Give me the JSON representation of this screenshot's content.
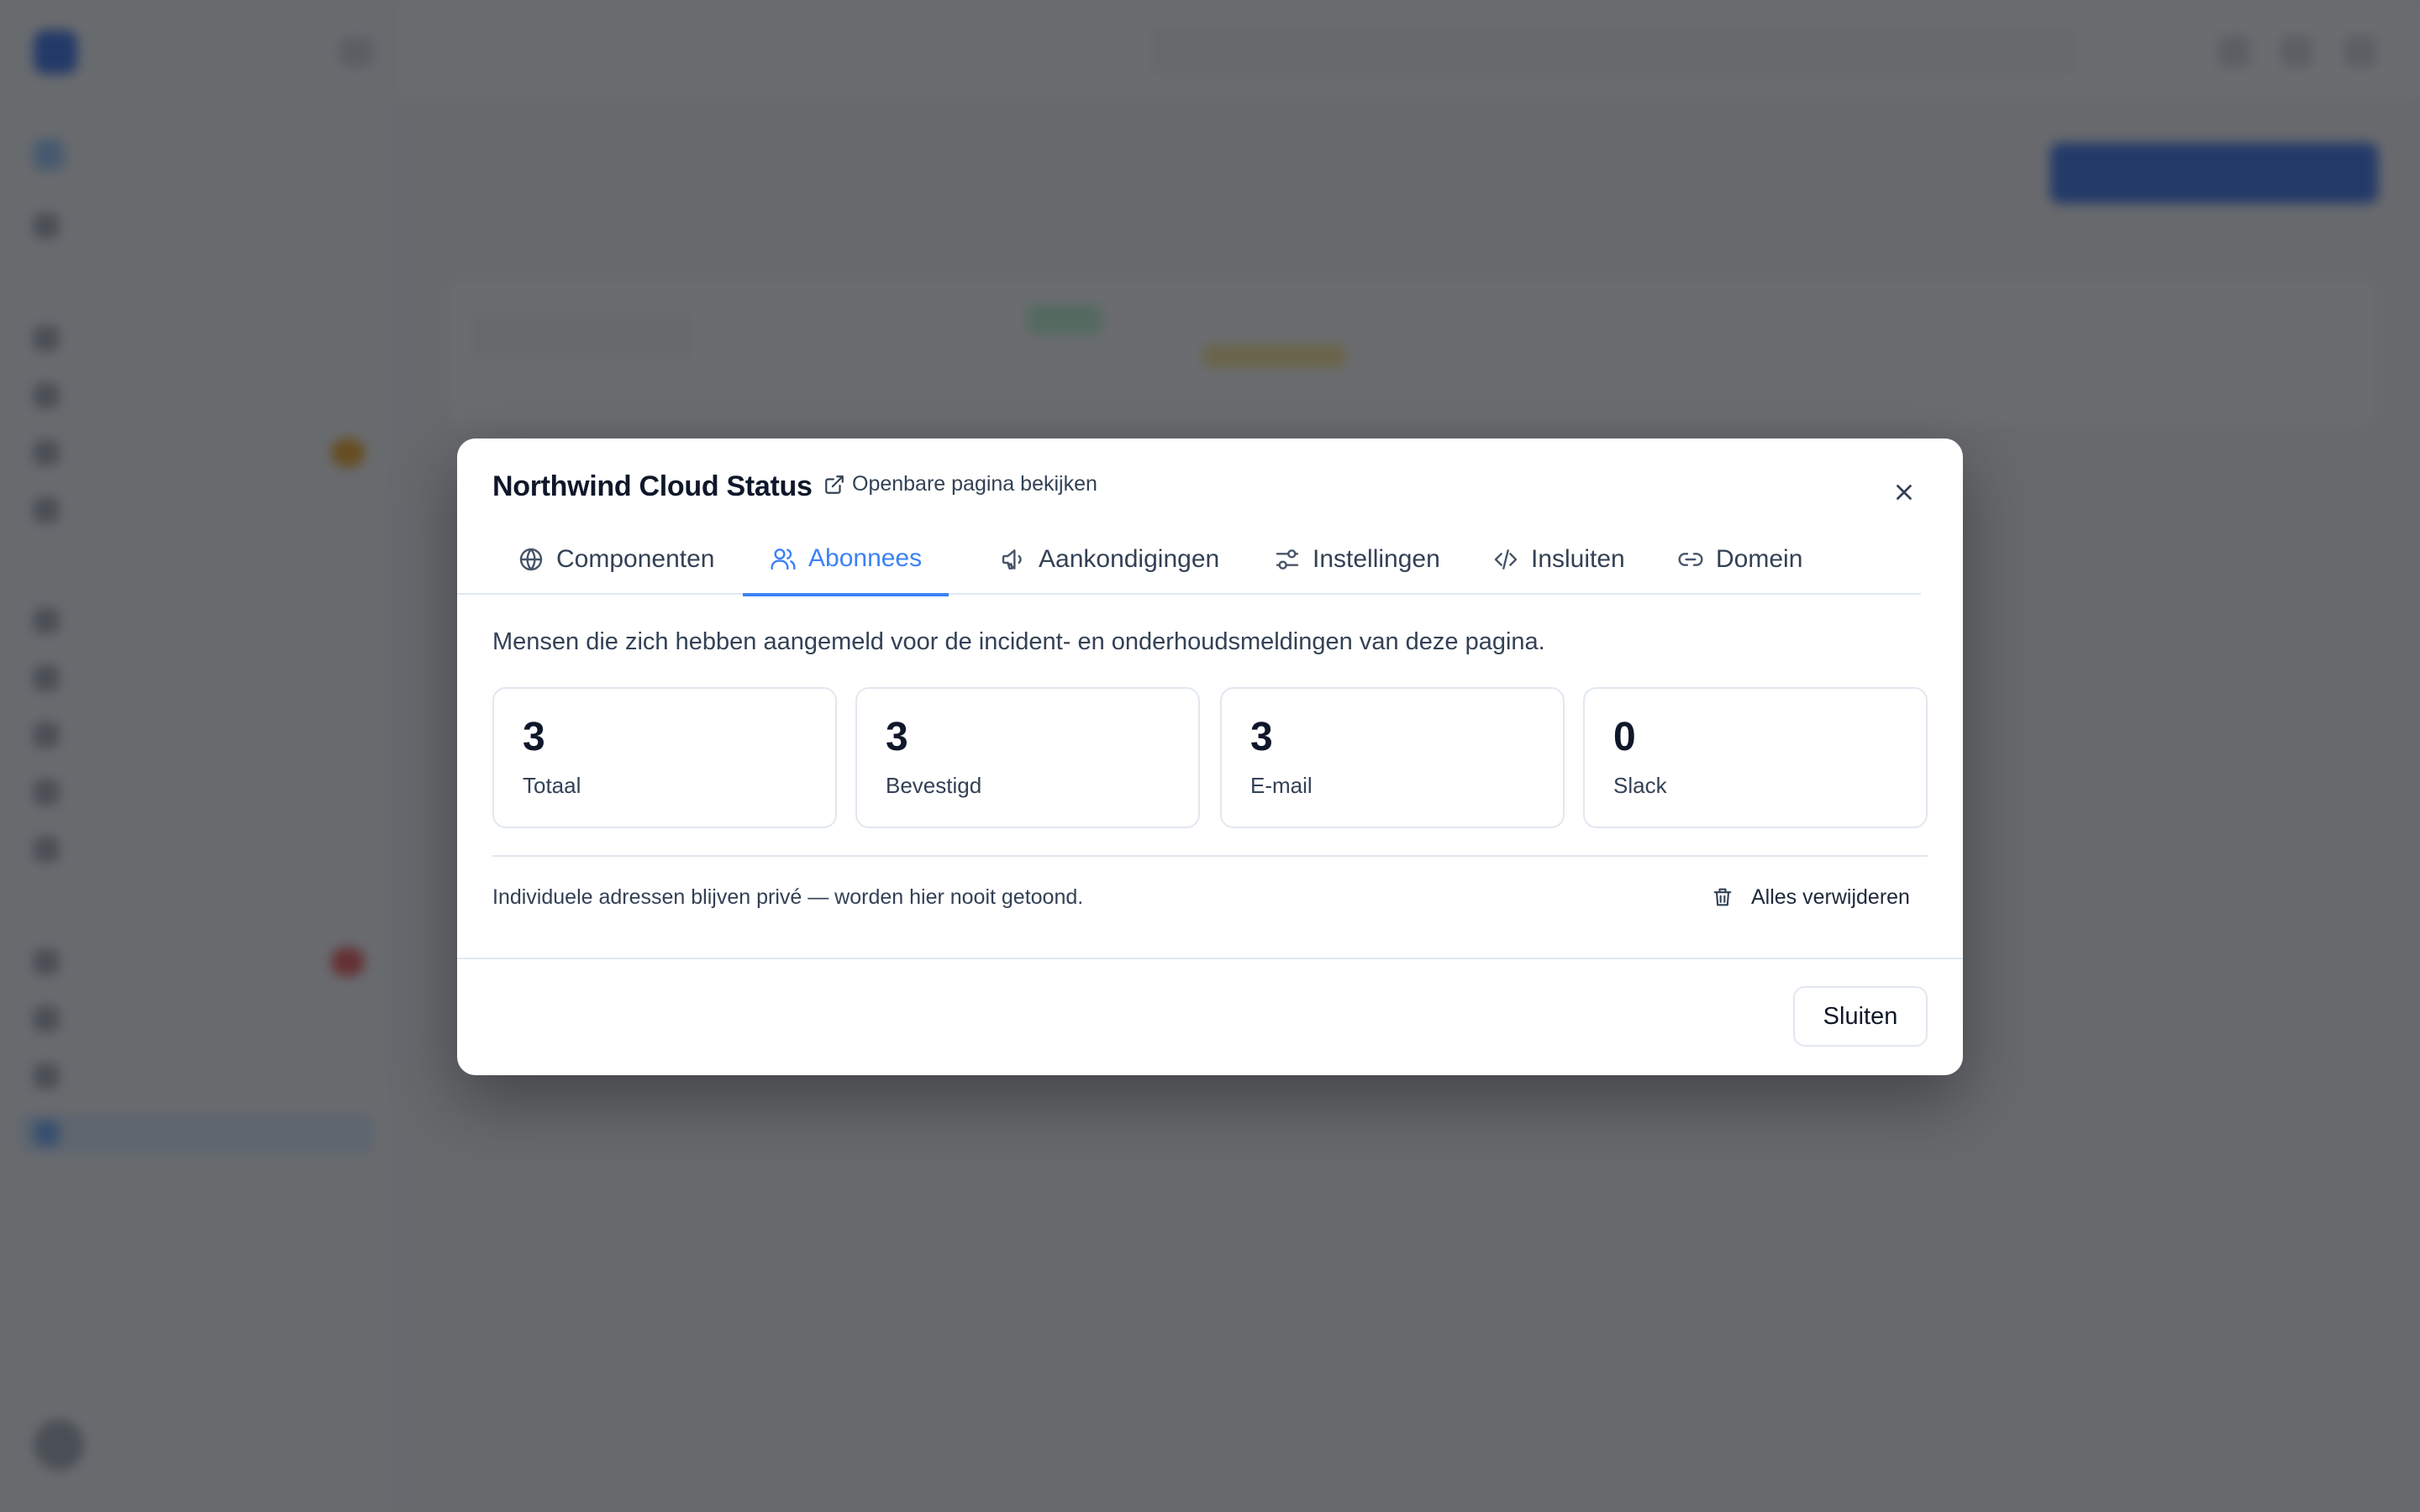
{
  "modal": {
    "title": "Northwind Cloud Status",
    "public_link_label": "Openbare pagina bekijken",
    "tabs": [
      {
        "label": "Componenten",
        "icon": "globe-icon"
      },
      {
        "label": "Abonnees",
        "icon": "users-icon",
        "active": true
      },
      {
        "label": "Aankondigingen",
        "icon": "megaphone-icon"
      },
      {
        "label": "Instellingen",
        "icon": "sliders-icon"
      },
      {
        "label": "Insluiten",
        "icon": "code-icon"
      },
      {
        "label": "Domein",
        "icon": "link-icon"
      }
    ],
    "description": "Mensen die zich hebben aangemeld voor de incident- en onderhoudsmeldingen van deze pagina.",
    "stats": [
      {
        "value": "3",
        "label": "Totaal"
      },
      {
        "value": "3",
        "label": "Bevestigd"
      },
      {
        "value": "3",
        "label": "E-mail"
      },
      {
        "value": "0",
        "label": "Slack"
      }
    ],
    "privacy_note": "Individuele adressen blijven privé — worden hier nooit getoond.",
    "delete_all_label": "Alles verwijderen",
    "close_label": "Sluiten"
  },
  "colors": {
    "accent": "#3b82f6",
    "overlay": "#23262b",
    "text_primary": "#0f172a",
    "text_secondary": "#334155",
    "border": "#e2e8f0"
  }
}
